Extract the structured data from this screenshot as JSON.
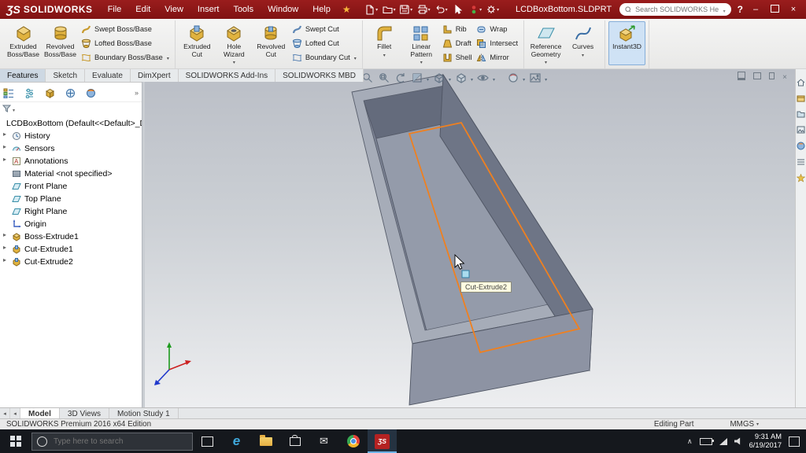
{
  "colors": {
    "titlebar_red": "#8e1a1a",
    "selection_orange": "#ef8020",
    "taskbar_dark": "#15181d",
    "instant3d_active_bg": "#cfe2f5",
    "model_gray": "#949baa"
  },
  "titlebar": {
    "logo_mark": "ƷS",
    "logo_text": "SOLIDWORKS",
    "menus": [
      "File",
      "Edit",
      "View",
      "Insert",
      "Tools",
      "Window",
      "Help"
    ],
    "document_title": "LCDBoxBottom.SLDPRT",
    "search_placeholder": "Search SOLIDWORKS Help",
    "help_label": "?"
  },
  "ribbon": {
    "tabs": [
      "Features",
      "Sketch",
      "Evaluate",
      "DimXpert",
      "SOLIDWORKS Add-Ins",
      "SOLIDWORKS MBD"
    ],
    "active_tab": "Features",
    "big": [
      "Extruded Boss/Base",
      "Revolved Boss/Base",
      "Extruded Cut",
      "Hole Wizard",
      "Revolved Cut",
      "Fillet",
      "Linear Pattern",
      "Reference Geometry",
      "Curves",
      "Instant3D"
    ],
    "small": [
      "Swept Boss/Base",
      "Lofted Boss/Base",
      "Boundary Boss/Base",
      "Swept Cut",
      "Lofted Cut",
      "Boundary Cut",
      "Rib",
      "Draft",
      "Shell",
      "Wrap",
      "Intersect",
      "Mirror"
    ]
  },
  "tree": {
    "root": "LCDBoxBottom (Default<<Default>_Dis",
    "items": [
      "History",
      "Sensors",
      "Annotations",
      "Material <not specified>",
      "Front Plane",
      "Top Plane",
      "Right Plane",
      "Origin",
      "Boss-Extrude1",
      "Cut-Extrude1",
      "Cut-Extrude2"
    ]
  },
  "viewport": {
    "tooltip": "Cut-Extrude2"
  },
  "doc_tabs": [
    "Model",
    "3D Views",
    "Motion Study 1"
  ],
  "statusbar": {
    "edition": "SOLIDWORKS Premium 2016 x64 Edition",
    "mode": "Editing Part",
    "units": "MMGS"
  },
  "taskbar": {
    "search_placeholder": "Type here to search",
    "time": "9:31 AM",
    "date": "6/19/2017"
  }
}
